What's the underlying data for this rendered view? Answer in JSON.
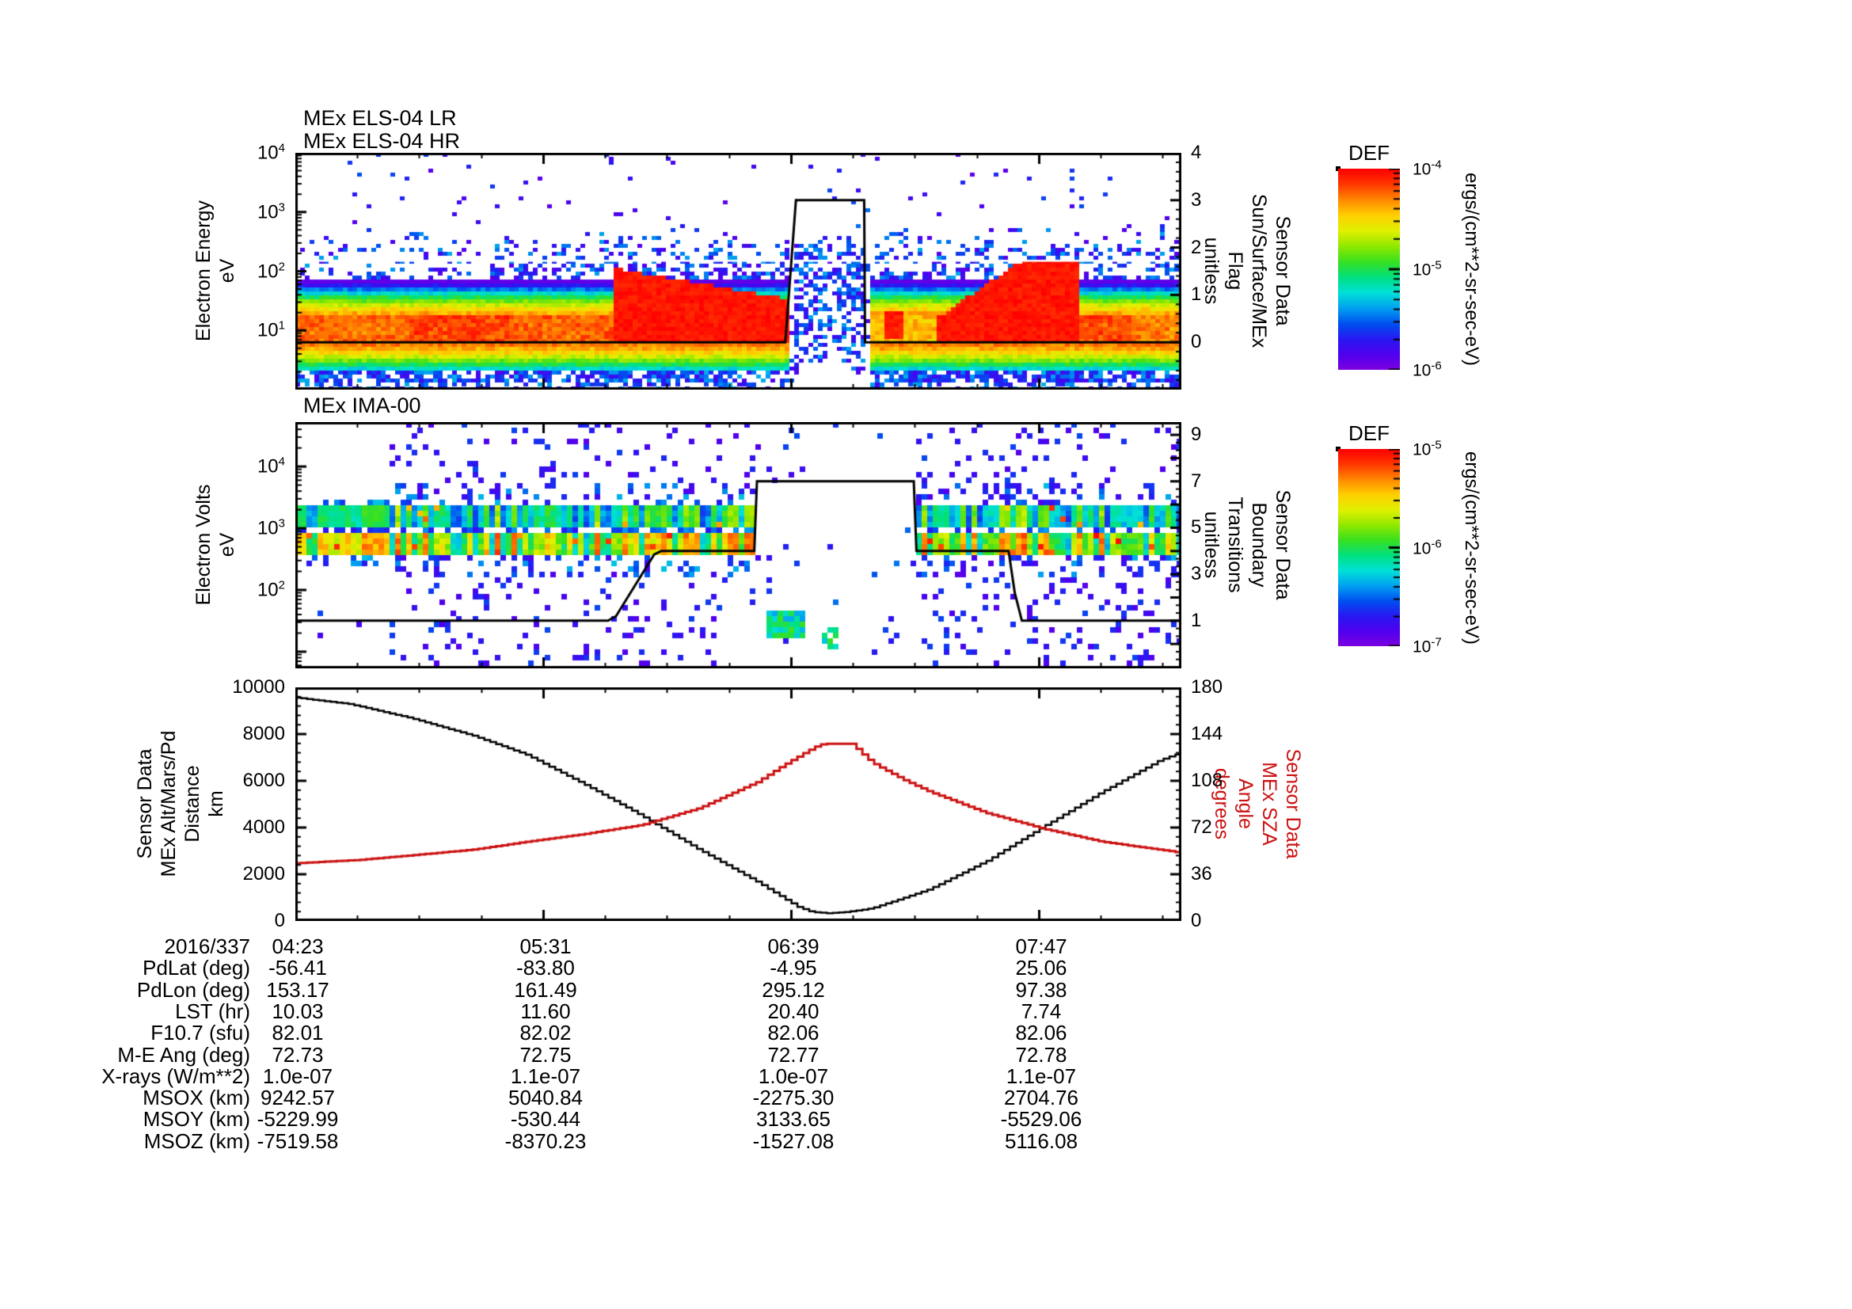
{
  "page": {
    "background": "#ffffff"
  },
  "colors": {
    "accent_red": "#cc1111",
    "line_black": "#000000",
    "colormap": [
      "#7d00e0",
      "#5000ee",
      "#2818f2",
      "#0050f0",
      "#00a0f0",
      "#00e0d8",
      "#00e080",
      "#38e020",
      "#90e800",
      "#e0f000",
      "#ffd000",
      "#ff8800",
      "#ff3800",
      "#ff0000"
    ]
  },
  "chart_data": [
    {
      "id": "els",
      "type": "heatmap",
      "title_lines": [
        "MEx ELS-04 LR",
        "MEx ELS-04 HR"
      ],
      "y_axis": {
        "label_lines": [
          "Electron Energy",
          "eV"
        ],
        "scale": "log",
        "min_exp": 0,
        "max_exp": 4,
        "tick_exps": [
          4,
          3,
          2,
          1
        ]
      },
      "right_axis": {
        "label_lines": [
          "Sensor Data",
          "Sun/Surface/MEx",
          "Flag",
          "unitless"
        ],
        "min": -1,
        "max": 4,
        "ticks": [
          4,
          3,
          2,
          1,
          0
        ]
      },
      "flag_line": {
        "name": "Sun/Surface/MEx Flag",
        "points": [
          [
            0,
            0
          ],
          [
            0.553,
            0
          ],
          [
            0.565,
            3
          ],
          [
            0.642,
            3
          ],
          [
            0.643,
            0
          ],
          [
            1,
            0
          ]
        ]
      },
      "model": {
        "gap": [
          0.555,
          0.645
        ],
        "gap_dense_col": [
          0.563,
          0.64
        ],
        "gap_white_col": [
          0.567,
          0.628,
          0.5
        ],
        "redA": [
          0.36,
          0.555
        ],
        "redA_top_start": 2.05,
        "redA_top_slope": 2.6,
        "streakB": [
          0.663,
          0.685
        ],
        "redB": [
          0.72,
          0.885
        ],
        "redB_top_base": 1.2,
        "redB_top_slope": 10,
        "redB_top_max": 2.2,
        "mid_after_gap": [
          0.645,
          0.72,
          0.76
        ],
        "core_L": [
          0.8,
          1.28
        ],
        "peak_L": 1.0,
        "peak_w": 0.62,
        "peak_v": 0.93,
        "core_v_by_x": [
          [
            0.13,
            0.85
          ],
          [
            0.24,
            0.89
          ],
          [
            0.36,
            0.86
          ],
          [
            0.885,
            0
          ],
          [
            0.94,
            0.88
          ],
          [
            1.01,
            0.83
          ]
        ],
        "speckle_zone_top": 2.75,
        "dot_density": 0.015,
        "dense_x": [
          [
            0.22,
            0.555
          ],
          [
            0.655,
            1.01
          ]
        ],
        "white_line_L": 2.18
      }
    },
    {
      "id": "ima",
      "type": "heatmap",
      "title_lines": [
        "MEx IMA-00"
      ],
      "y_axis": {
        "label_lines": [
          "Electron Volts",
          "eV"
        ],
        "scale": "log",
        "min_exp_f": 0.73,
        "max_exp_f": 4.72,
        "tick_exps": [
          4,
          3,
          2
        ]
      },
      "right_axis": {
        "label_lines": [
          "Sensor Data",
          "Boundary",
          "Transitions",
          "unitless"
        ],
        "min": -1.05,
        "max": 9.55,
        "ticks": [
          9,
          7,
          5,
          3,
          1
        ]
      },
      "flag_line": {
        "name": "Boundary Transitions",
        "points": [
          [
            0,
            1
          ],
          [
            0.353,
            1
          ],
          [
            0.362,
            1.2
          ],
          [
            0.405,
            3.85
          ],
          [
            0.413,
            4
          ],
          [
            0.518,
            4
          ],
          [
            0.521,
            7
          ],
          [
            0.698,
            7
          ],
          [
            0.701,
            4
          ],
          [
            0.805,
            4
          ],
          [
            0.812,
            2.2
          ],
          [
            0.82,
            1
          ],
          [
            1,
            1
          ]
        ]
      },
      "model": {
        "quiet_end": 0.105,
        "gap": [
          0.52,
          0.7
        ],
        "bandA": [
          2.58,
          2.95
        ],
        "bandB": [
          3.02,
          3.38
        ],
        "ext_low": [
          2.2,
          2.58
        ],
        "ext_high": [
          3.38,
          3.75
        ],
        "noise_density_1": 0.1,
        "noise_density_2": 0.12,
        "gap_density": 0.025,
        "blob1": [
          0.53,
          0.575,
          1.3,
          1.7
        ],
        "blob2": [
          0.595,
          0.615,
          1.05,
          1.4
        ],
        "red_cluster": [
          0.7,
          0.73,
          2.7,
          3.0
        ]
      }
    },
    {
      "id": "orbit",
      "type": "line",
      "left_axis": {
        "label_lines": [
          "Sensor Data",
          "MEx Alt/Mars/Pd",
          "Distance",
          "km"
        ],
        "min": 0,
        "max": 10000,
        "ticks": [
          10000,
          8000,
          6000,
          4000,
          2000,
          0
        ],
        "minor_step": 400
      },
      "right_axis": {
        "label_lines": [
          "Sensor Data",
          "MEx SZA",
          "Angle",
          "degrees"
        ],
        "min": 0,
        "max": 180,
        "ticks": [
          180,
          144,
          108,
          72,
          36,
          0
        ],
        "minor_step": 7.2,
        "color": "#cc1111"
      },
      "x_axis": {
        "date_label": "2016/337",
        "tick_labels": [
          "04:23",
          "05:31",
          "06:39",
          "07:47"
        ],
        "tick_fracs": [
          0.0,
          0.2797,
          0.5595,
          0.8392
        ],
        "minor_per_interval": 4
      },
      "series": [
        {
          "name": "MEx Alt/Mars/Pd Distance km",
          "axis": "left",
          "color": "#000000",
          "points": [
            [
              0,
              9560
            ],
            [
              0.06,
              9290
            ],
            [
              0.13,
              8680
            ],
            [
              0.2,
              7930
            ],
            [
              0.26,
              7120
            ],
            [
              0.325,
              5860
            ],
            [
              0.39,
              4510
            ],
            [
              0.455,
              3050
            ],
            [
              0.52,
              1690
            ],
            [
              0.566,
              610
            ],
            [
              0.582,
              390
            ],
            [
              0.6,
              330
            ],
            [
              0.622,
              390
            ],
            [
              0.65,
              540
            ],
            [
              0.715,
              1360
            ],
            [
              0.78,
              2580
            ],
            [
              0.845,
              4070
            ],
            [
              0.91,
              5530
            ],
            [
              0.975,
              6880
            ],
            [
              1,
              7220
            ]
          ]
        },
        {
          "name": "MEx SZA Angle degrees",
          "axis": "right",
          "color": "#cc1111",
          "points": [
            [
              0,
              44.5
            ],
            [
              0.07,
              47
            ],
            [
              0.13,
              50.6
            ],
            [
              0.2,
              55
            ],
            [
              0.26,
              61
            ],
            [
              0.325,
              67
            ],
            [
              0.39,
              74
            ],
            [
              0.455,
              87
            ],
            [
              0.52,
              107
            ],
            [
              0.55,
              120
            ],
            [
              0.585,
              134
            ],
            [
              0.595,
              136.5
            ],
            [
              0.627,
              136.5
            ],
            [
              0.65,
              122
            ],
            [
              0.685,
              109
            ],
            [
              0.715,
              99.5
            ],
            [
              0.78,
              83
            ],
            [
              0.845,
              70.8
            ],
            [
              0.91,
              61
            ],
            [
              0.975,
              54.9
            ],
            [
              1,
              52.5
            ]
          ]
        }
      ]
    }
  ],
  "colorbars": [
    {
      "title": "DEF",
      "tick_exps": [
        -4,
        -5,
        -6
      ],
      "unit": "ergs/(cm**2-sr-sec-eV)"
    },
    {
      "title": "DEF",
      "tick_exps": [
        -5,
        -6,
        -7
      ],
      "unit": "ergs/(cm**2-sr-sec-eV)"
    }
  ],
  "table": {
    "rows": [
      {
        "label": "PdLat (deg)",
        "values": [
          "-56.41",
          "-83.80",
          "-4.95",
          "25.06"
        ]
      },
      {
        "label": "PdLon (deg)",
        "values": [
          "153.17",
          "161.49",
          "295.12",
          "97.38"
        ]
      },
      {
        "label": "LST (hr)",
        "values": [
          "10.03",
          "11.60",
          "20.40",
          "7.74"
        ]
      },
      {
        "label": "F10.7 (sfu)",
        "values": [
          "82.01",
          "82.02",
          "82.06",
          "82.06"
        ]
      },
      {
        "label": "M-E Ang (deg)",
        "values": [
          "72.73",
          "72.75",
          "72.77",
          "72.78"
        ]
      },
      {
        "label": "X-rays (W/m**2)",
        "values": [
          "1.0e-07",
          "1.1e-07",
          "1.0e-07",
          "1.1e-07"
        ]
      },
      {
        "label": "MSOX (km)",
        "values": [
          "9242.57",
          "5040.84",
          "-2275.30",
          "2704.76"
        ]
      },
      {
        "label": "MSOY (km)",
        "values": [
          "-5229.99",
          "-530.44",
          "3133.65",
          "-5529.06"
        ]
      },
      {
        "label": "MSOZ (km)",
        "values": [
          "-7519.58",
          "-8370.23",
          "-1527.08",
          "5116.08"
        ]
      }
    ]
  }
}
